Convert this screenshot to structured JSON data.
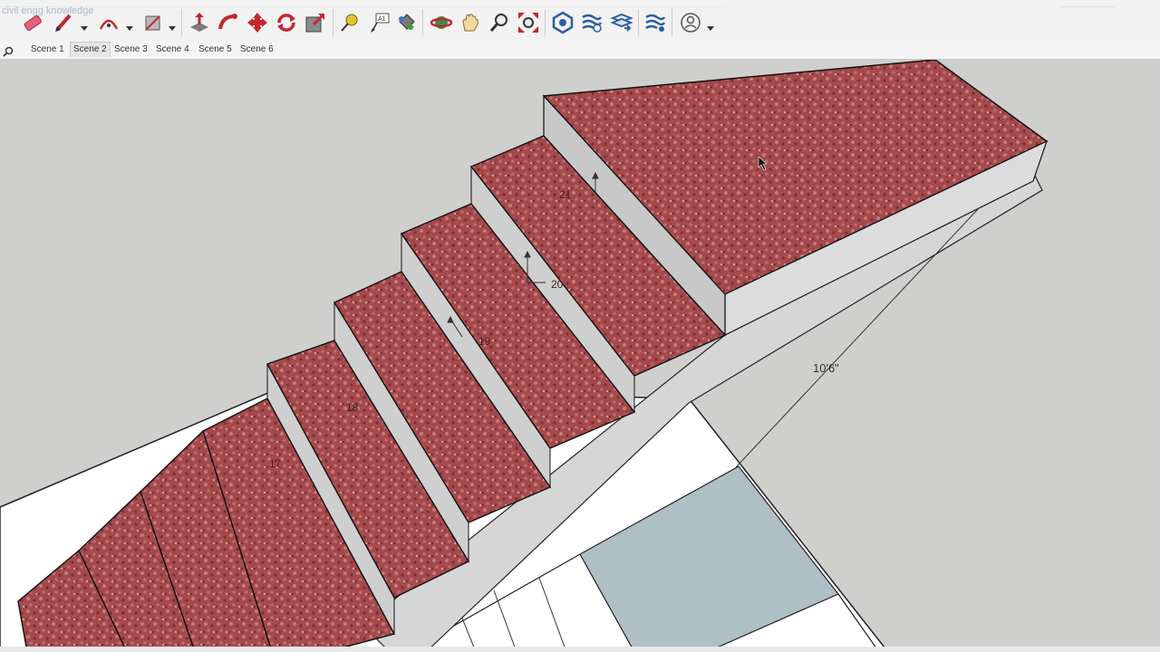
{
  "watermark": "civil engg knowledge",
  "scenes": [
    "Scene 1",
    "Scene 2",
    "Scene 3",
    "Scene 4",
    "Scene 5",
    "Scene 6"
  ],
  "active_scene": "Scene 2",
  "toolbar_icons": [
    "eraser-icon",
    "pencil-icon",
    "arc-icon",
    "rectangle-icon",
    "push-pull-icon",
    "follow-me-icon",
    "move-icon",
    "rotate-icon",
    "scale-icon",
    "tape-measure-icon",
    "text-icon",
    "paint-bucket-icon",
    "orbit-icon",
    "pan-icon",
    "zoom-icon",
    "zoom-extents-icon",
    "warehouse-icon",
    "extension-icon",
    "layers-icon",
    "sandbox-icon",
    "account-icon"
  ],
  "model": {
    "dimension": "10'6\"",
    "step_labels": [
      "17",
      "18",
      "19",
      "20",
      "21"
    ]
  },
  "colors": {
    "tread": "#a34a4c",
    "riser": "#d9d9d9",
    "ground": "#cfcfcd",
    "slab": "#aebfc6"
  }
}
